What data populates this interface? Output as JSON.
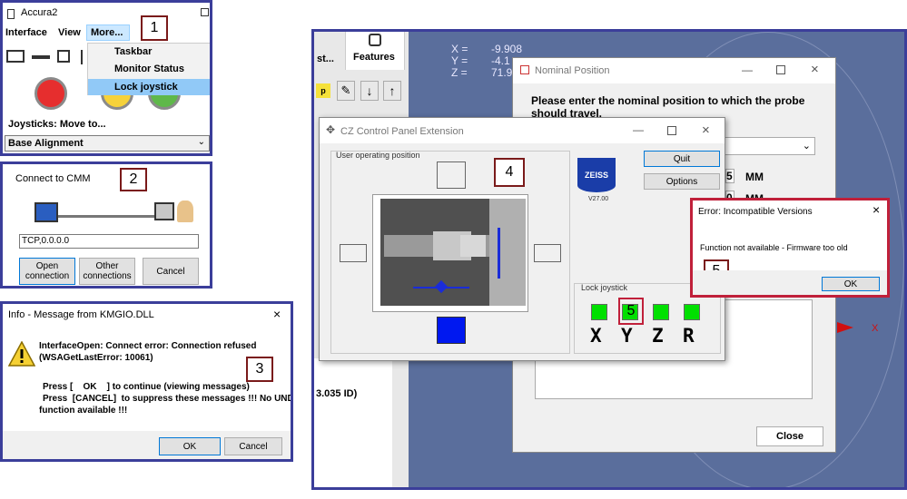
{
  "accura": {
    "title": "Accura2",
    "menu": [
      "Interface",
      "View",
      "More..."
    ],
    "dropdown": [
      "Taskbar",
      "Monitor Status",
      "Lock joystick"
    ],
    "joysticks_label": "Joysticks: Move to...",
    "base_alignment": "Base Alignment",
    "badge": "1"
  },
  "connect": {
    "title": "Connect to CMM",
    "badge": "2",
    "address": "TCP,0.0.0.0",
    "open_label": "Open connection",
    "other_label": "Other connections",
    "cancel_label": "Cancel"
  },
  "info": {
    "title": "Info - Message from KMGIO.DLL",
    "badge": "3",
    "line1": "InterfaceOpen: Connect error:  Connection refused",
    "line2": "(WSAGetLastError: 10061)",
    "line3": "Press [    OK    ] to continue (viewing messages)",
    "line4": "Press  [CANCEL]  to suppress these messages !!! No UNDO",
    "line5": "function available !!!",
    "ok_label": "OK",
    "cancel_label": "Cancel"
  },
  "main": {
    "tab_partial": "st...",
    "tab_features": "Features",
    "coord_x_label": "X =",
    "coord_x_value": "-9.908",
    "coord_y_label": "Y =",
    "coord_y_value": "-4.1",
    "coord_z_label": "Z =",
    "coord_z_value": "71.9",
    "left_value": "3.035 ID)",
    "axis_x": "X"
  },
  "nominal": {
    "title": "Nominal Position",
    "prompt": "Please enter the nominal position to which the probe should travel.",
    "val1": "5",
    "unit1": "MM",
    "val2": "0",
    "unit2": "MM",
    "close_label": "Close"
  },
  "cz": {
    "title": "CZ Control Panel Extension",
    "operating_label": "User operating position",
    "badge": "4",
    "logo": "ZEISS",
    "version": "V27.00",
    "quit_label": "Quit",
    "options_label": "Options",
    "lock_label": "Lock joystick",
    "axes": [
      "X",
      "Y",
      "Z",
      "R"
    ],
    "badge5": "5"
  },
  "error": {
    "title": "Error: Incompatible Versions",
    "message": "Function not available -  Firmware too old",
    "badge": "5",
    "ok_label": "OK"
  }
}
